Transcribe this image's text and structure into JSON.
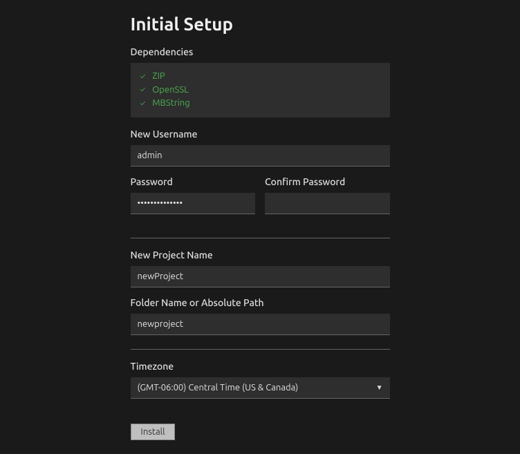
{
  "title": "Initial Setup",
  "dependencies": {
    "label": "Dependencies",
    "items": [
      "ZIP",
      "OpenSSL",
      "MBString"
    ]
  },
  "username": {
    "label": "New Username",
    "value": "admin"
  },
  "password": {
    "label": "Password",
    "value": "••••••••••••••"
  },
  "confirm_password": {
    "label": "Confirm Password",
    "value": ""
  },
  "project_name": {
    "label": "New Project Name",
    "value": "newProject"
  },
  "folder": {
    "label": "Folder Name or Absolute Path",
    "value": "newproject"
  },
  "timezone": {
    "label": "Timezone",
    "selected": "(GMT-06:00) Central Time (US & Canada)"
  },
  "install_label": "Install"
}
